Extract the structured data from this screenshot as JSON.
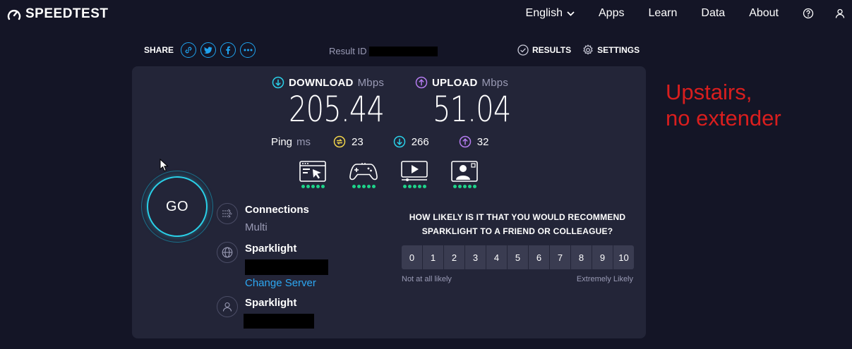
{
  "header": {
    "logo": "SPEEDTEST",
    "nav": [
      {
        "label": "English"
      },
      {
        "label": "Apps"
      },
      {
        "label": "Learn"
      },
      {
        "label": "Data"
      },
      {
        "label": "About"
      }
    ]
  },
  "share": {
    "label": "SHARE"
  },
  "result": {
    "label": "Result ID"
  },
  "actions": {
    "results": "RESULTS",
    "settings": "SETTINGS"
  },
  "download": {
    "label": "DOWNLOAD",
    "unit": "Mbps",
    "value": "205.44"
  },
  "upload": {
    "label": "UPLOAD",
    "unit": "Mbps",
    "value": "51.04"
  },
  "ping": {
    "label": "Ping",
    "unit": "ms",
    "idle": "23",
    "download": "266",
    "upload": "32"
  },
  "go": {
    "label": "GO"
  },
  "connections": {
    "title": "Connections",
    "value": "Multi"
  },
  "server": {
    "title": "Sparklight",
    "change_label": "Change Server"
  },
  "provider": {
    "title": "Sparklight"
  },
  "survey": {
    "question_line1": "HOW LIKELY IS IT THAT YOU WOULD RECOMMEND",
    "question_line2": "SPARKLIGHT TO A FRIEND OR COLLEAGUE?",
    "scale": [
      "0",
      "1",
      "2",
      "3",
      "4",
      "5",
      "6",
      "7",
      "8",
      "9",
      "10"
    ],
    "low_label": "Not at all likely",
    "high_label": "Extremely Likely"
  },
  "annotation": {
    "line1": "Upstairs,",
    "line2": "no extender"
  },
  "colors": {
    "background": "#141526",
    "panel": "#232538",
    "download_accent": "#2ad0e8",
    "upload_accent": "#b57cf0",
    "ping_accent": "#f1d44a",
    "link": "#2da7f1",
    "quality_dot": "#1dd38a",
    "annotation": "#d91e1e"
  }
}
